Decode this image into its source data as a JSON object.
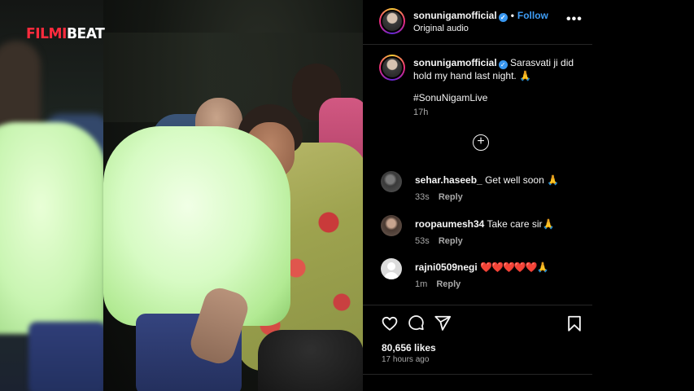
{
  "watermark": {
    "part1": "FILMI",
    "part2": "BEAT"
  },
  "post": {
    "header": {
      "username": "sonunigamofficial",
      "follow_label": "Follow",
      "separator": "•",
      "audio_label": "Original audio",
      "more_label": "•••"
    },
    "caption": {
      "username": "sonunigamofficial",
      "text": "Sarasvati ji did hold my hand last night. 🙏",
      "hashtag": "#SonuNigamLive",
      "time": "17h"
    },
    "load_more_icon": "plus-circle-icon",
    "comments": [
      {
        "user": "sehar.haseeb_",
        "text": "Get well soon 🙏",
        "time": "33s",
        "reply": "Reply"
      },
      {
        "user": "roopaumesh34",
        "text": "Take care sir🙏",
        "time": "53s",
        "reply": "Reply"
      },
      {
        "user": "rajni0509negi",
        "hearts": "❤️❤️❤️❤️❤️",
        "text": "🙏",
        "time": "1m",
        "reply": "Reply"
      }
    ],
    "actions": {
      "icons": [
        "heart-icon",
        "comment-icon",
        "share-icon",
        "save-icon"
      ],
      "likes": "80,656 likes",
      "posted": "17 hours ago"
    }
  },
  "colors": {
    "accent_blue": "#3f9df5",
    "brand_red": "#ff2b3d",
    "background": "#000000",
    "muted_text": "#a8a8a8"
  }
}
